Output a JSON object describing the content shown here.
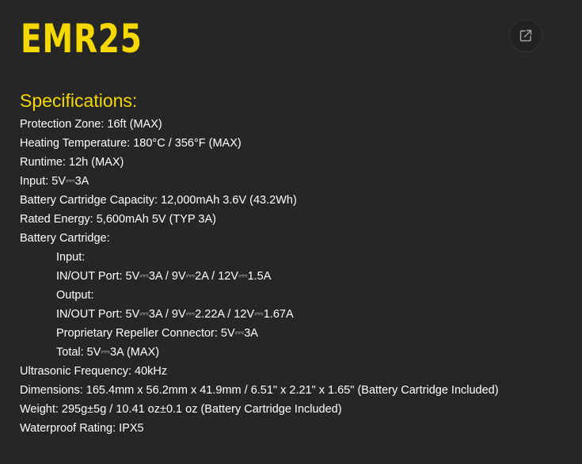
{
  "brand": {
    "title": "EMR25",
    "accent_color": "#f5d800"
  },
  "share_button": {
    "icon": "share-icon"
  },
  "specifications": {
    "heading": "Specifications:",
    "lines": [
      "Protection Zone: 16ft (MAX)",
      "Heating Temperature: 180°C / 356°F (MAX)",
      "Runtime: 12h (MAX)",
      "Input: 5V⎓3A",
      "Battery Cartridge Capacity: 12,000mAh 3.6V (43.2Wh)",
      "Rated Energy: 5,600mAh 5V (TYP 3A)",
      "Battery Cartridge:",
      "Input:",
      "IN/OUT Port: 5V⎓3A / 9V⎓2A / 12V⎓1.5A",
      "Output:",
      "IN/OUT Port: 5V⎓3A / 9V⎓2.22A / 12V⎓1.67A",
      "Proprietary Repeller Connector: 5V⎓3A",
      "Total: 5V⎓3A (MAX)",
      "Ultrasonic Frequency: 40kHz",
      "Dimensions: 165.4mm x 56.2mm x 41.9mm / 6.51\" x 2.21\" x 1.65\" (Battery Cartridge Included)",
      "Weight: 295g±5g / 10.41 oz±0.1 oz (Battery Cartridge Included)",
      "Waterproof Rating: IPX5"
    ]
  }
}
